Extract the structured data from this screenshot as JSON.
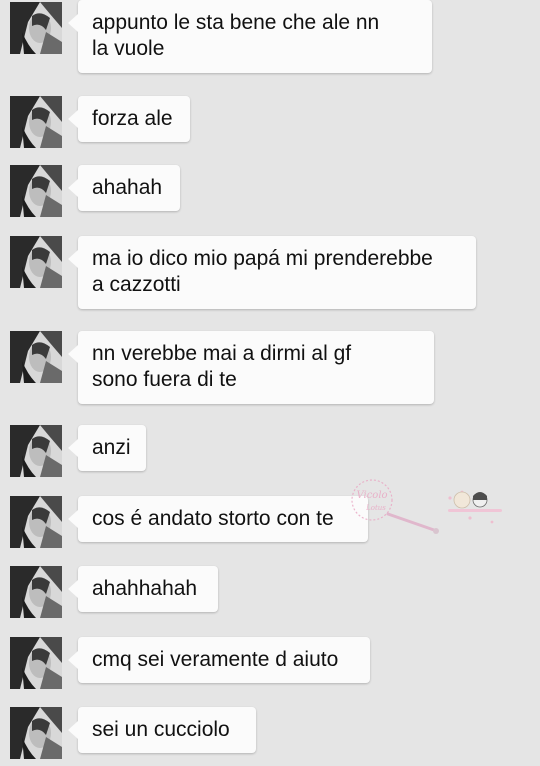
{
  "messages": [
    {
      "lines": [
        "appunto le sta bene che ale nn",
        "la vuole"
      ]
    },
    {
      "lines": [
        "forza ale"
      ]
    },
    {
      "lines": [
        "ahahah"
      ]
    },
    {
      "lines": [
        "ma io dico mio papá mi prenderebbe",
        "a cazzotti"
      ]
    },
    {
      "lines": [
        "nn verebbe mai a dirmi al gf",
        "sono fuera di te"
      ]
    },
    {
      "lines": [
        "anzi"
      ]
    },
    {
      "lines": [
        "cos é andato storto con te"
      ]
    },
    {
      "lines": [
        "ahahhahah"
      ]
    },
    {
      "lines": [
        "cmq sei veramente d aiuto"
      ]
    },
    {
      "lines": [
        "sei un cucciolo"
      ]
    }
  ],
  "avatar_icon": "contact-photo-icon",
  "watermark": {
    "text_main": "Vicolo",
    "text_sub": "Lotus"
  },
  "colors": {
    "background": "#e5e5e5",
    "bubble": "#fbfbfb",
    "text": "#111111",
    "watermark": "#e9a8c4"
  }
}
